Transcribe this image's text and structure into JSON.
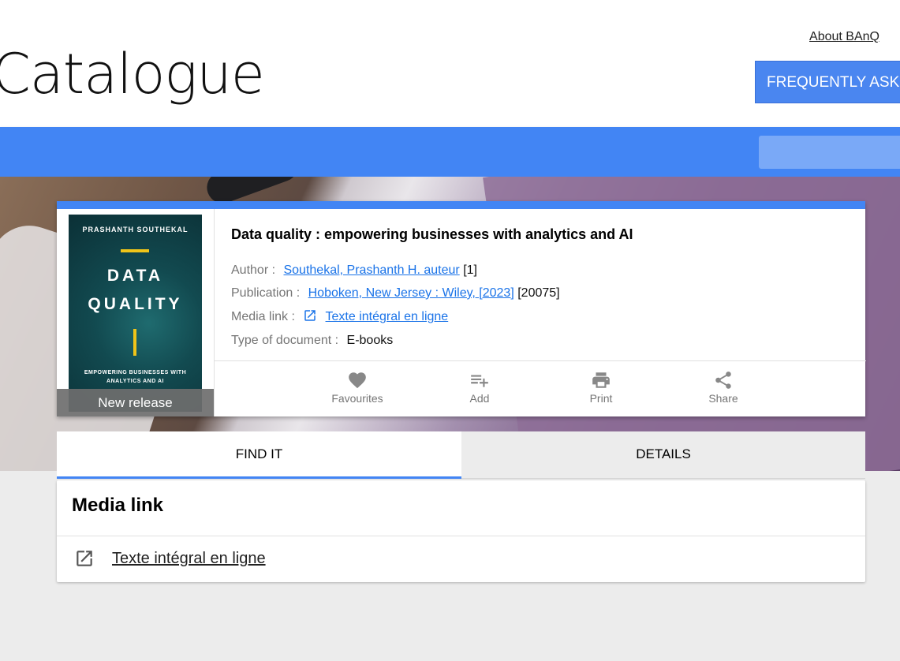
{
  "header": {
    "site_title": "Catalogue",
    "about_link": "About BAnQ",
    "faq_button": "FREQUENTLY ASKED"
  },
  "record": {
    "badge": "New release",
    "cover": {
      "author": "PRASHANTH SOUTHEKAL",
      "title_line1": "DATA",
      "title_line2": "QUALITY",
      "subtitle": "EMPOWERING BUSINESSES WITH ANALYTICS AND AI"
    },
    "title": "Data quality : empowering businesses with analytics and AI",
    "author_label": "Author :",
    "author_value": "Southekal, Prashanth H. auteur",
    "author_suffix": "[1]",
    "publication_label": "Publication :",
    "publication_value": "Hoboken, New Jersey : Wiley, [2023]",
    "publication_suffix": "[20075]",
    "medialink_label": "Media link :",
    "medialink_value": "Texte intégral en ligne",
    "doctype_label": "Type of document :",
    "doctype_value": "E-books",
    "actions": [
      {
        "label": "Favourites",
        "icon": "heart-icon"
      },
      {
        "label": "Add",
        "icon": "playlist-add-icon"
      },
      {
        "label": "Print",
        "icon": "printer-icon"
      },
      {
        "label": "Share",
        "icon": "share-icon"
      }
    ]
  },
  "tabs": [
    {
      "label": "FIND IT",
      "active": true
    },
    {
      "label": "DETAILS",
      "active": false
    }
  ],
  "media_section": {
    "title": "Media link",
    "link": "Texte intégral en ligne"
  },
  "colors": {
    "primary": "#4285f4",
    "link": "#1a73e8"
  }
}
